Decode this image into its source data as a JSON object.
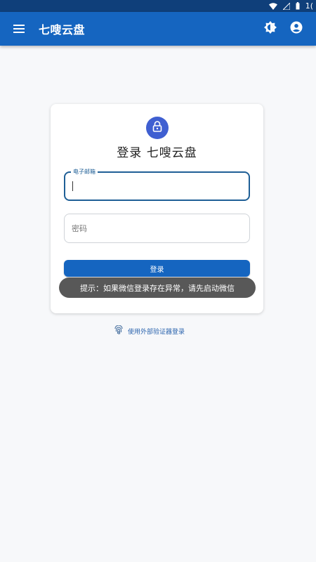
{
  "status_bar": {
    "time": "1("
  },
  "app_bar": {
    "title": "七嗖云盘"
  },
  "login": {
    "title": "登录 七嗖云盘",
    "email_label": "电子邮箱",
    "email_value": "",
    "password_placeholder": "密码",
    "login_button": "登录"
  },
  "toast": {
    "message": "提示：如果微信登录存在异常，请先启动微信"
  },
  "external_login": {
    "label": "使用外部验证器登录"
  },
  "colors": {
    "app_bar": "#1565c0",
    "status_bar": "#0f3f7a",
    "accent": "#3f5fd1",
    "focused_border": "#1f5f96"
  }
}
